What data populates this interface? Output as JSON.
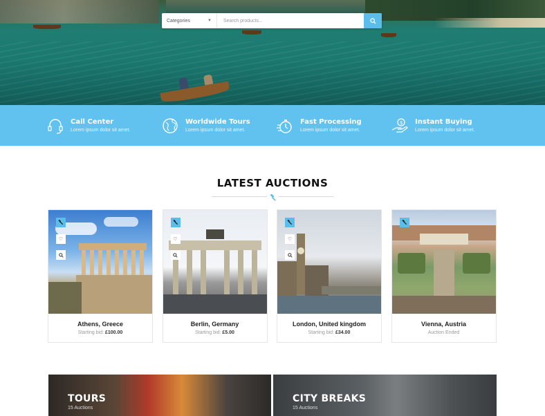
{
  "hero": {
    "search": {
      "category_label": "Categories",
      "placeholder": "Search products..."
    }
  },
  "features": [
    {
      "icon": "headset-icon",
      "title": "Call Center",
      "desc": "Lorem ipsum dolor sit amet."
    },
    {
      "icon": "globe-icon",
      "title": "Worldwide Tours",
      "desc": "Lorem ipsum dolor sit amet."
    },
    {
      "icon": "stopwatch-icon",
      "title": "Fast Processing",
      "desc": "Lorem ipsum dolor sit amet."
    },
    {
      "icon": "hand-money-icon",
      "title": "Instant Buying",
      "desc": "Lorem ipsum dolor sit amet."
    }
  ],
  "auctions": {
    "heading": "LATEST AUCTIONS",
    "items": [
      {
        "city": "Athens, Greece",
        "bid_label": "Starting bid:",
        "bid_value": "£100.00"
      },
      {
        "city": "Berlin, Germany",
        "bid_label": "Starting bid:",
        "bid_value": "£5.00"
      },
      {
        "city": "London, United kingdom",
        "bid_label": "Starting bid:",
        "bid_value": "£34.00"
      },
      {
        "city": "Vienna, Austria",
        "bid_label": "Auction Ended",
        "bid_value": ""
      }
    ]
  },
  "categories": [
    {
      "name": "TOURS",
      "count": "15 Auctions"
    },
    {
      "name": "CITY BREAKS",
      "count": "15 Auctions"
    }
  ],
  "colors": {
    "accent": "#5bbde9",
    "feature_band": "#62c2ef"
  }
}
